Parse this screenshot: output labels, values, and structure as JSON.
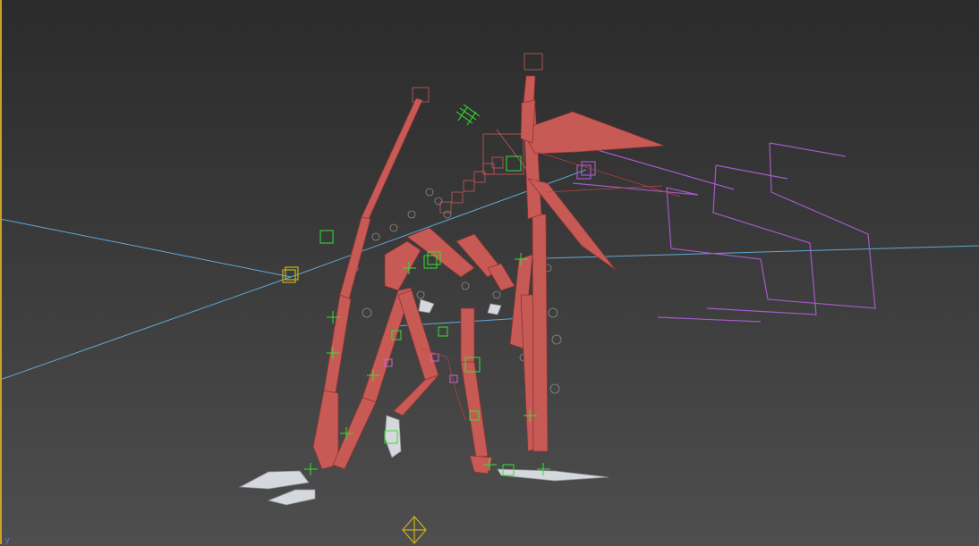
{
  "viewport": {
    "background_top": "#2b2b2b",
    "background_bottom": "#4e4e4e",
    "active_border_color": "#c9a227",
    "axis_indicator": "y"
  },
  "scene": {
    "subject": "creature-rig",
    "bone_color": "#c85a56",
    "helper_color": "#35e035",
    "gizmo_color": "#a35ac8",
    "camera_line_color": "#5fa8d6",
    "claw_color": "#d5d8dc",
    "dummy_color": "#c9b21a"
  }
}
